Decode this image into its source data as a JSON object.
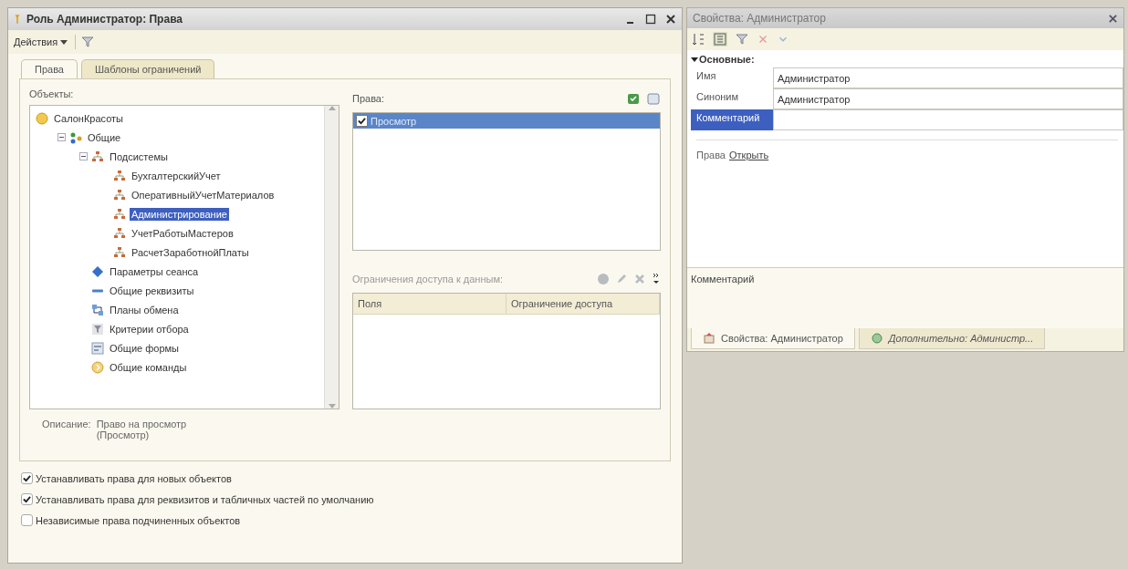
{
  "main_window": {
    "title": "Роль Администратор: Права",
    "actions_menu": "Действия",
    "tabs": [
      {
        "label": "Права",
        "selected": true
      },
      {
        "label": "Шаблоны ограничений",
        "selected": false
      }
    ],
    "objects": {
      "label": "Объекты:",
      "tree": [
        {
          "label": "СалонКрасоты",
          "kind": "config",
          "selected": false,
          "children": [
            {
              "label": "Общие",
              "kind": "group",
              "expanded": true,
              "selected": false,
              "children": [
                {
                  "label": "Подсистемы",
                  "kind": "subsystem",
                  "expanded": true,
                  "selected": false,
                  "children": [
                    {
                      "label": "БухгалтерскийУчет",
                      "kind": "subsystem",
                      "selected": false
                    },
                    {
                      "label": "ОперативныйУчетМатериалов",
                      "kind": "subsystem",
                      "selected": false
                    },
                    {
                      "label": "Администрирование",
                      "kind": "subsystem",
                      "selected": true
                    },
                    {
                      "label": "УчетРаботыМастеров",
                      "kind": "subsystem",
                      "selected": false
                    },
                    {
                      "label": "РасчетЗаработнойПлаты",
                      "kind": "subsystem",
                      "selected": false
                    }
                  ]
                },
                {
                  "label": "Параметры сеанса",
                  "kind": "session",
                  "selected": false
                },
                {
                  "label": "Общие реквизиты",
                  "kind": "attribute",
                  "selected": false
                },
                {
                  "label": "Планы обмена",
                  "kind": "exchange",
                  "selected": false
                },
                {
                  "label": "Критерии отбора",
                  "kind": "filter",
                  "selected": false
                },
                {
                  "label": "Общие формы",
                  "kind": "form",
                  "selected": false
                },
                {
                  "label": "Общие команды",
                  "kind": "command",
                  "selected": false
                }
              ]
            }
          ]
        }
      ]
    },
    "rights": {
      "label": "Права:",
      "items": [
        {
          "label": "Просмотр",
          "checked": true,
          "selected": true
        }
      ]
    },
    "restrictions": {
      "label": "Ограничения доступа к данным:",
      "columns": [
        "Поля",
        "Ограничение доступа"
      ]
    },
    "description": {
      "label": "Описание:",
      "lines": [
        "Право на просмотр",
        "(Просмотр)"
      ]
    },
    "options": [
      {
        "label": "Устанавливать права для новых объектов",
        "checked": true
      },
      {
        "label": "Устанавливать права для реквизитов и табличных частей по умолчанию",
        "checked": true
      },
      {
        "label": "Независимые права подчиненных объектов",
        "checked": false
      }
    ]
  },
  "properties_panel": {
    "title": "Свойства: Администратор",
    "group": {
      "label": "Основные:",
      "expanded": true
    },
    "fields": [
      {
        "label": "Имя",
        "value": "Администратор",
        "selected": false
      },
      {
        "label": "Синоним",
        "value": "Администратор",
        "selected": false
      },
      {
        "label": "Комментарий",
        "selected": true
      }
    ],
    "rights_label": "Права",
    "rights_link": "Открыть",
    "hint": "Комментарий",
    "tabs": [
      {
        "label": "Свойства: Администратор",
        "selected": true
      },
      {
        "label": "Дополнительно: Администр...",
        "selected": false
      }
    ]
  }
}
